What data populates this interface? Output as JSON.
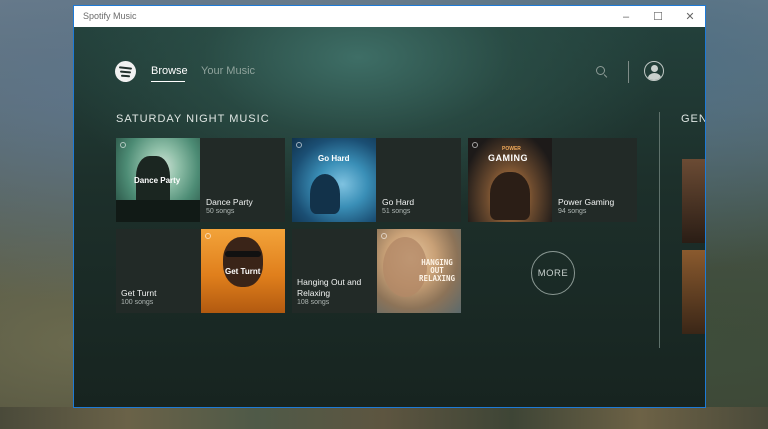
{
  "window": {
    "title": "Spotify Music",
    "controls": [
      "–",
      "☐",
      "✕"
    ]
  },
  "nav": {
    "browse": "Browse",
    "your_music": "Your Music"
  },
  "section": {
    "title": "SATURDAY NIGHT MUSIC",
    "next_title_partial": "GEN",
    "more_label": "MORE"
  },
  "playlists": [
    {
      "name": "Dance Party",
      "count": "50 songs",
      "art_text": "Dance Party"
    },
    {
      "name": "Go Hard",
      "count": "51 songs",
      "art_text": "Go Hard"
    },
    {
      "name": "Power Gaming",
      "count": "94 songs",
      "art_text_top": "POWER",
      "art_text": "GAMING"
    },
    {
      "name": "Get Turnt",
      "count": "100 songs",
      "art_text": "Get Turnt"
    },
    {
      "name": "Hanging Out and Relaxing",
      "count": "108 songs",
      "art_text": "HANGING OUT RELAXING"
    }
  ],
  "colors": {
    "accent": "#1e7ad6",
    "text": "#ffffff",
    "muted": "#8fa39c"
  }
}
